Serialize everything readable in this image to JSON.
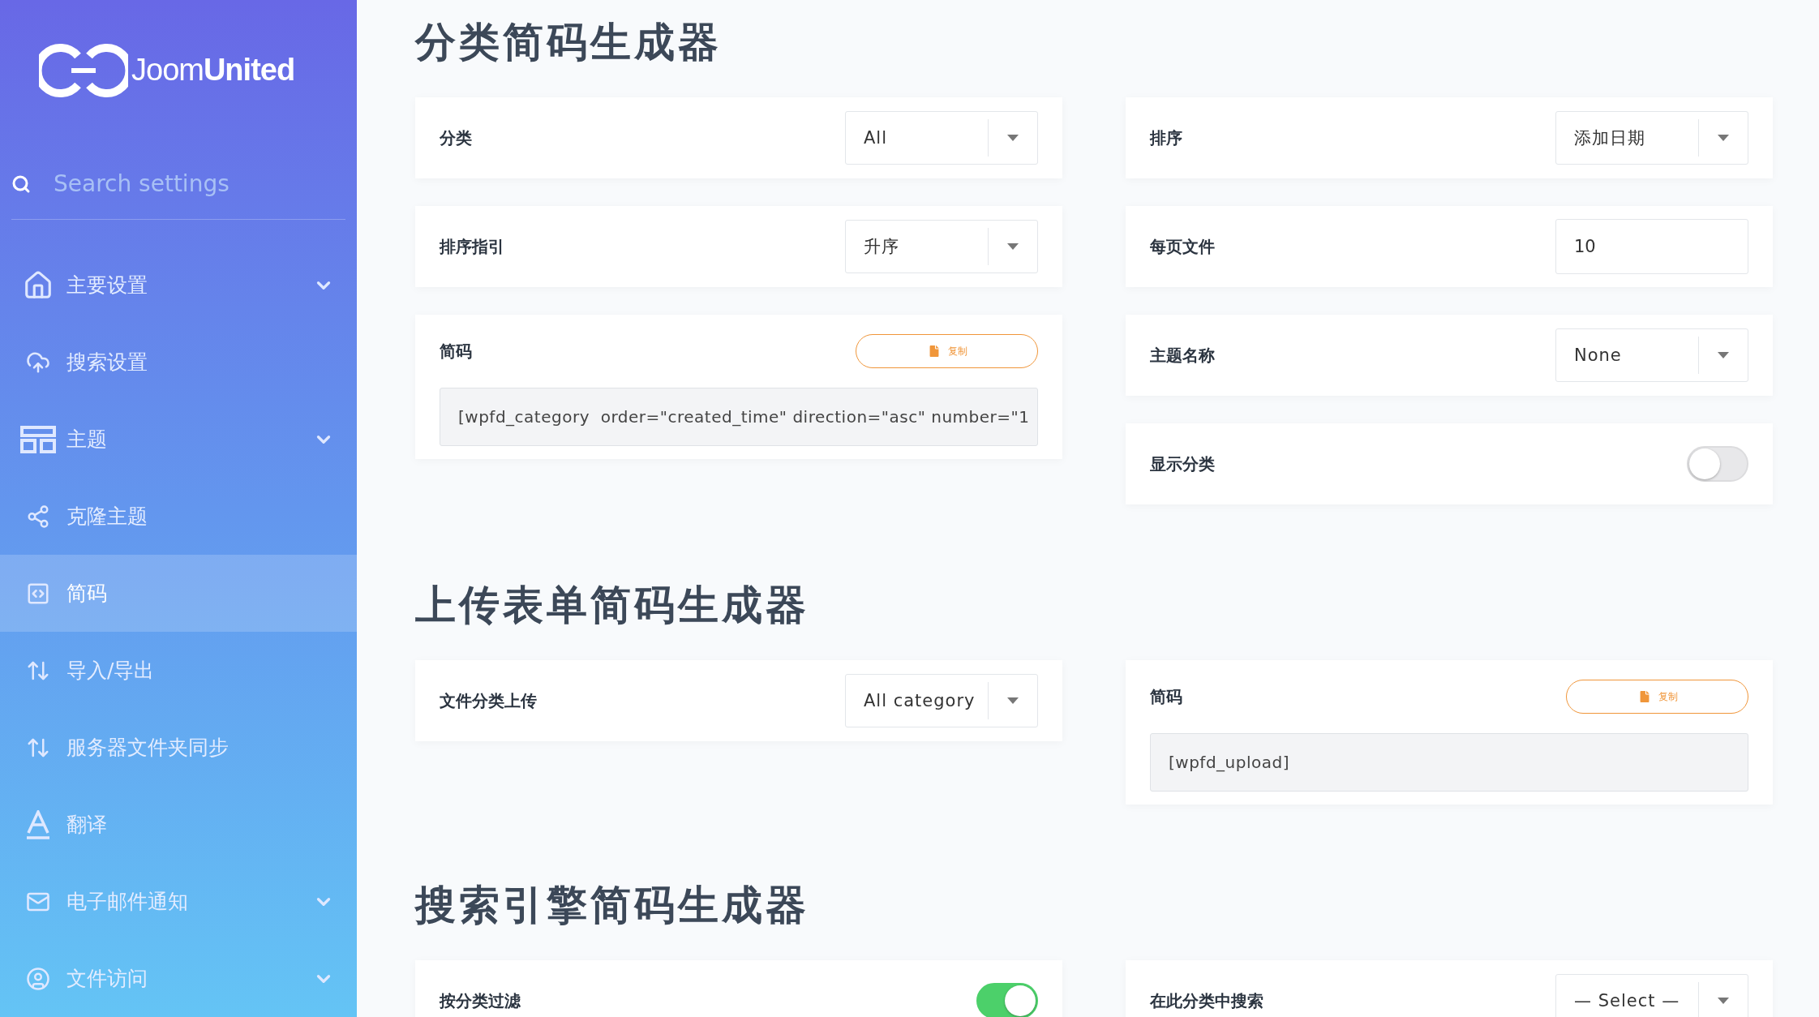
{
  "sidebar": {
    "logo": {
      "light": "Joom",
      "bold": "United"
    },
    "search": {
      "placeholder": "Search settings"
    },
    "items": [
      {
        "label": "主要设置",
        "expandable": true,
        "selected": false
      },
      {
        "label": "搜索设置",
        "expandable": false,
        "selected": false
      },
      {
        "label": "主题",
        "expandable": true,
        "selected": false
      },
      {
        "label": "克隆主题",
        "expandable": false,
        "selected": false
      },
      {
        "label": "简码",
        "expandable": false,
        "selected": true
      },
      {
        "label": "导入/导出",
        "expandable": false,
        "selected": false
      },
      {
        "label": "服务器文件夹同步",
        "expandable": false,
        "selected": false
      },
      {
        "label": "翻译",
        "expandable": false,
        "selected": false
      },
      {
        "label": "电子邮件通知",
        "expandable": true,
        "selected": false
      },
      {
        "label": "文件访问",
        "expandable": true,
        "selected": false
      }
    ]
  },
  "sections": [
    {
      "title": "分类简码生成器",
      "columns": [
        [
          {
            "kind": "select",
            "label": "分类",
            "value": "All"
          },
          {
            "kind": "select",
            "label": "排序指引",
            "value": "升序"
          },
          {
            "kind": "shortcode",
            "label": "简码",
            "button": "复制",
            "value": "[wpfd_category  order=\"created_time\" direction=\"asc\" number=\"1"
          }
        ],
        [
          {
            "kind": "select",
            "label": "排序",
            "value": "添加日期"
          },
          {
            "kind": "input",
            "label": "每页文件",
            "value": "10"
          },
          {
            "kind": "select",
            "label": "主题名称",
            "value": "None"
          },
          {
            "kind": "toggle",
            "label": "显示分类",
            "on": false
          }
        ]
      ]
    },
    {
      "title": "上传表单简码生成器",
      "columns": [
        [
          {
            "kind": "select",
            "label": "文件分类上传",
            "value": "All category"
          }
        ],
        [
          {
            "kind": "shortcode",
            "label": "简码",
            "button": "复制",
            "value": "[wpfd_upload]"
          }
        ]
      ]
    },
    {
      "title": "搜索引擎简码生成器",
      "columns": [
        [
          {
            "kind": "toggle",
            "label": "按分类过滤",
            "on": true
          }
        ],
        [
          {
            "kind": "select",
            "label": "在此分类中搜索",
            "value": "— Select —"
          }
        ]
      ]
    }
  ]
}
